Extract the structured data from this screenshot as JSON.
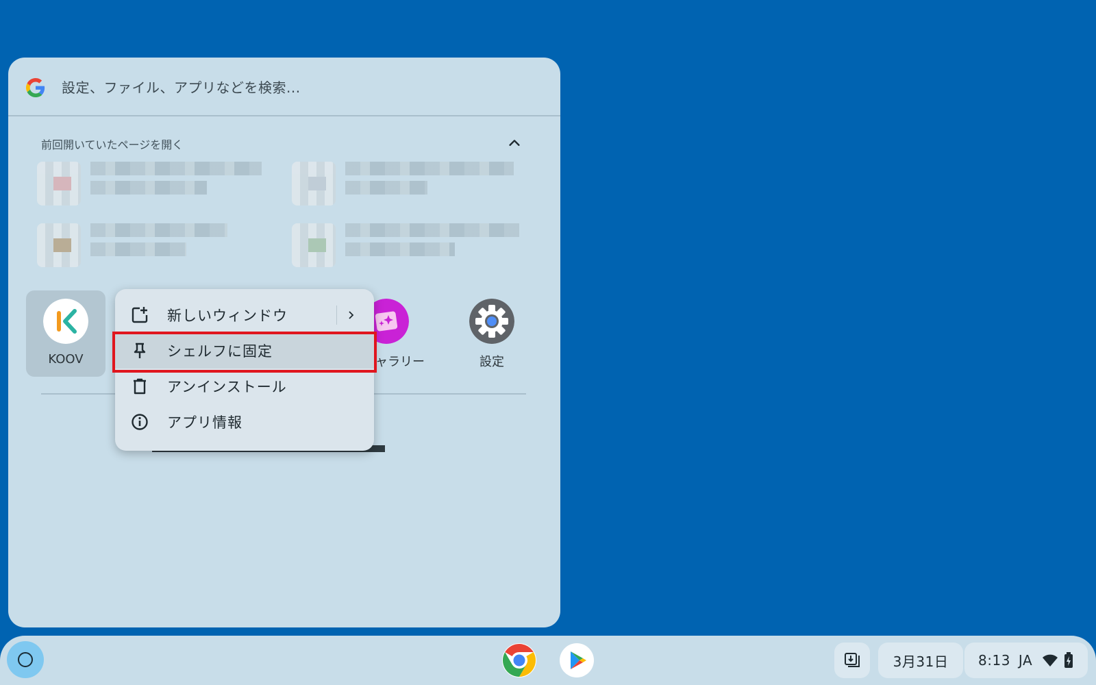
{
  "launcher": {
    "search_placeholder": "設定、ファイル、アプリなどを検索...",
    "continue_section_title": "前回開いていたページを開く",
    "apps": [
      {
        "label": "KOOV",
        "icon": "koov-icon"
      },
      {
        "label": "ャラリー",
        "icon": "gallery-icon"
      },
      {
        "label": "設定",
        "icon": "settings-gear-icon"
      }
    ]
  },
  "context_menu": {
    "items": [
      {
        "label": "新しいウィンドウ",
        "icon": "new-window-icon"
      },
      {
        "label": "シェルフに固定",
        "icon": "pin-icon"
      },
      {
        "label": "アンインストール",
        "icon": "trash-icon"
      },
      {
        "label": "アプリ情報",
        "icon": "info-icon"
      }
    ]
  },
  "shelf": {
    "apps": [
      {
        "name": "Chrome",
        "icon": "chrome-icon"
      },
      {
        "name": "Play Store",
        "icon": "play-store-icon"
      }
    ],
    "date": "3月31日",
    "time": "8:13",
    "ime": "JA"
  },
  "colors": {
    "desktop": "#0063b1",
    "panel": "#c8dde9",
    "highlight_border": "#e0161e"
  }
}
